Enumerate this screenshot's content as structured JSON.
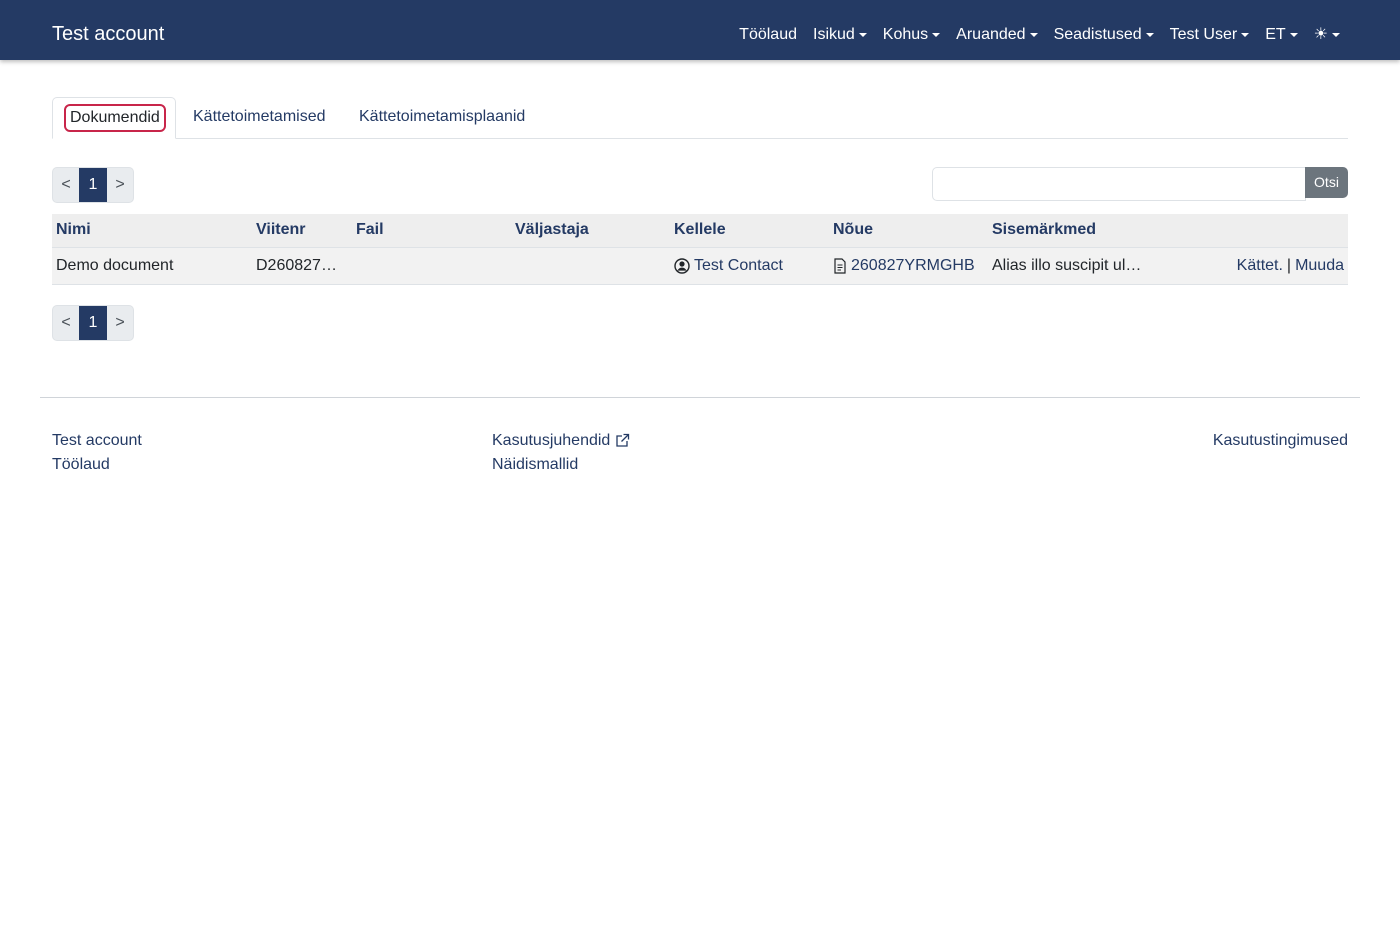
{
  "navbar": {
    "brand": "Test account",
    "items": [
      {
        "label": "Töölaud",
        "dropdown": false
      },
      {
        "label": "Isikud",
        "dropdown": true
      },
      {
        "label": "Kohus",
        "dropdown": true
      },
      {
        "label": "Aruanded",
        "dropdown": true
      },
      {
        "label": "Seadistused",
        "dropdown": true
      },
      {
        "label": "Test User",
        "dropdown": true
      },
      {
        "label": "ET",
        "dropdown": true
      }
    ],
    "theme_icon": "☀"
  },
  "tabs": [
    {
      "label": "Dokumendid",
      "active": true
    },
    {
      "label": "Kättetoimetamised",
      "active": false
    },
    {
      "label": "Kättetoimetamisplaanid",
      "active": false
    }
  ],
  "pagination": {
    "prev": "<",
    "current": "1",
    "next": ">"
  },
  "search": {
    "value": "",
    "placeholder": "",
    "button": "Otsi"
  },
  "table": {
    "headers": [
      "Nimi",
      "Viitenr",
      "Fail",
      "Väljastaja",
      "Kellele",
      "Nõue",
      "Sisemärkmed"
    ],
    "rows": [
      {
        "nimi": "Demo document",
        "viitenr": "D260827…",
        "fail": "",
        "valjastaja": "",
        "kellele": "Test Contact",
        "noue": "260827YRMGHB",
        "sisemarkmed": "Alias illo suscipit ul…",
        "action_deliver": "Kättet.",
        "action_separator": "|",
        "action_edit": "Muuda"
      }
    ]
  },
  "footer": {
    "brand": "Test account",
    "dashboard": "Töölaud",
    "guides": "Kasutusjuhendid",
    "templates": "Näidismallid",
    "terms": "Kasutustingimused"
  },
  "colors": {
    "navbar_bg": "#243a64",
    "link": "#243a64",
    "focus_outline": "#c8254a",
    "search_button": "#6c757d"
  }
}
